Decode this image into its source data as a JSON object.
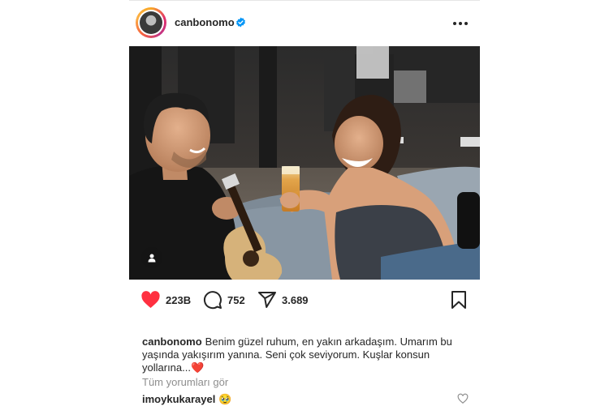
{
  "post": {
    "username": "canbonomo",
    "verified": true,
    "likes": "223B",
    "comments_count": "752",
    "shares_count": "3.689",
    "caption_user": "canbonomo",
    "caption_text": "Benim güzel ruhum, en yakın arkadaşım. Umarım bu yaşında yakışırım yanına. Seni çok seviyorum. Kuşlar konsun yollarına...",
    "caption_emoji": "❤️",
    "view_comments_label": "Tüm yorumları gör",
    "top_comment": {
      "user": "imoykukarayel",
      "text": "🥹"
    }
  },
  "icons": {
    "more": "more-options-icon",
    "like": "heart-icon",
    "comment": "comment-bubble-icon",
    "share": "share-icon",
    "save": "bookmark-icon",
    "tag": "user-tag-icon",
    "verified": "verified-badge-icon"
  },
  "colors": {
    "like_red": "#ff3040",
    "verified_blue": "#0095f6",
    "muted_text": "#8e8e8e"
  }
}
